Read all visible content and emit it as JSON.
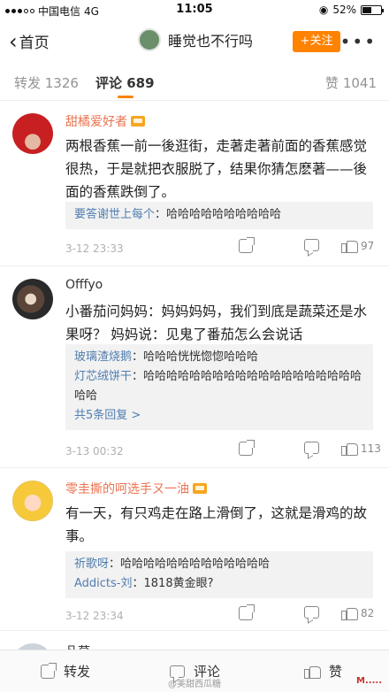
{
  "status_bar": {
    "carrier": "中国电信",
    "network": "4G",
    "time": "11:05",
    "battery": "52%",
    "battery_level": 0.52
  },
  "nav": {
    "back_label": "首页",
    "title": "睡觉也不行吗",
    "follow_label": "+关注",
    "more_label": "•••"
  },
  "tabs": {
    "repost": "转发 1326",
    "comments": "评论 689",
    "likes": "赞 1041",
    "active": "comments"
  },
  "comments": [
    {
      "author": "甜橘爱好者",
      "text": "两根香蕉一前一後逛街，走著走著前面的香蕉感觉很热，于是就把衣服脱了，结果你猜怎麽著——後面的香蕉跌倒了。",
      "replies": [
        {
          "who": "要答谢世上每个",
          "text": "哈哈哈哈哈哈哈哈哈哈"
        }
      ],
      "time": "3-12 23:33",
      "likes": "97"
    },
    {
      "author": "Offfyo",
      "text": "小番茄问妈妈：妈妈妈妈，我们到底是蔬菜还是水果呀？ 妈妈说：见鬼了番茄怎么会说话",
      "replies": [
        {
          "who": "玻璃渣烧鹅",
          "text": "哈哈哈恍恍惚惚哈哈哈"
        },
        {
          "who": "灯芯绒饼干",
          "text": "哈哈哈哈哈哈哈哈哈哈哈哈哈哈哈哈哈哈哈哈哈"
        }
      ],
      "more_replies": "共5条回复 >",
      "time": "3-13 00:32",
      "likes": "113"
    },
    {
      "author": "零圭撕的呵选手ㄡ一油",
      "text": "有一天，有只鸡走在路上滑倒了，这就是滑鸡的故事。",
      "replies": [
        {
          "who": "祈歌呀",
          "text": "哈哈哈哈哈哈哈哈哈哈哈哈哈"
        },
        {
          "who": "Addicts-刘",
          "text": "1818黄金眼?"
        }
      ],
      "time": "3-12 23:34",
      "likes": "82"
    },
    {
      "author": "凡莫"
    }
  ],
  "bottom_bar": {
    "repost": "转发",
    "comment": "评论",
    "like": "赞"
  },
  "watermark": "@美甜西瓜糖",
  "corner_logo": "M....."
}
